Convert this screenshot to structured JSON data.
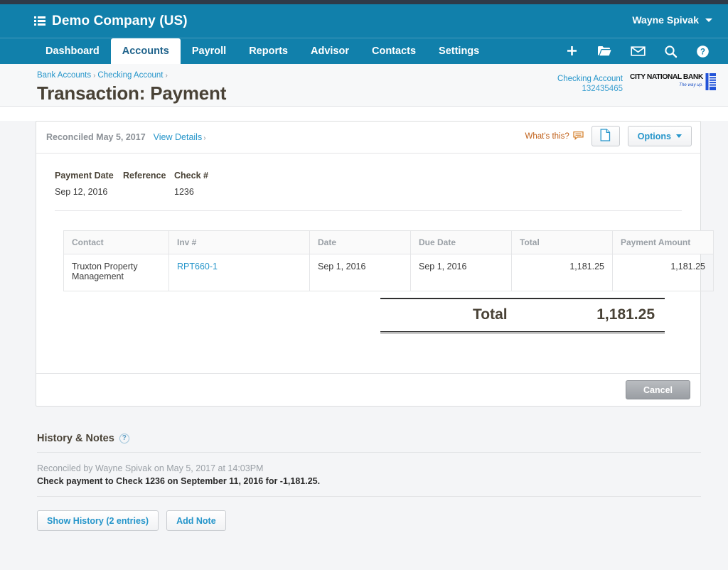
{
  "appbar": {
    "menu_icon": "list-icon",
    "company": "Demo Company (US)",
    "user": "Wayne Spivak",
    "nav": [
      {
        "label": "Dashboard",
        "active": false
      },
      {
        "label": "Accounts",
        "active": true
      },
      {
        "label": "Payroll",
        "active": false
      },
      {
        "label": "Reports",
        "active": false
      },
      {
        "label": "Advisor",
        "active": false
      },
      {
        "label": "Contacts",
        "active": false
      },
      {
        "label": "Settings",
        "active": false
      }
    ],
    "icons": [
      {
        "name": "plus-icon",
        "glyph": "+"
      },
      {
        "name": "folder-icon",
        "glyph": "folder"
      },
      {
        "name": "envelope-icon",
        "glyph": "envelope"
      },
      {
        "name": "search-icon",
        "glyph": "search"
      },
      {
        "name": "help-icon",
        "glyph": "?"
      }
    ]
  },
  "subheader": {
    "breadcrumb": [
      {
        "label": "Bank Accounts"
      },
      {
        "label": "Checking Account"
      }
    ],
    "separator": "›",
    "title": "Transaction: Payment",
    "account_name": "Checking Account",
    "account_number": "132435465",
    "bank_name_1": "C",
    "bank_name": "ITY ",
    "bank_logo_text": "CITY NATIONAL BANK",
    "bank_tagline": "The way up."
  },
  "card": {
    "status": "Reconciled May 5, 2017",
    "view_details": "View Details",
    "view_details_sep": "›",
    "whats_this": "What's this?",
    "document_button_icon": "document-icon",
    "options_label": "Options",
    "meta": [
      {
        "label": "Payment Date",
        "value": "Sep 12, 2016"
      },
      {
        "label": "Reference",
        "value": ""
      },
      {
        "label": "Check #",
        "value": "1236"
      }
    ],
    "table": {
      "columns": [
        {
          "label": "Contact",
          "align": "left"
        },
        {
          "label": "Inv #",
          "align": "left"
        },
        {
          "label": "Date",
          "align": "left"
        },
        {
          "label": "Due Date",
          "align": "left"
        },
        {
          "label": "Total",
          "align": "right"
        },
        {
          "label": "Payment Amount",
          "align": "right"
        }
      ],
      "rows": [
        {
          "contact": "Truxton Property Management",
          "inv": "RPT660-1",
          "date": "Sep 1, 2016",
          "due_date": "Sep 1, 2016",
          "total": "1,181.25",
          "payment_amount": "1,181.25"
        }
      ]
    },
    "total_label": "Total",
    "total_value": "1,181.25",
    "cancel_label": "Cancel"
  },
  "history": {
    "title": "History & Notes",
    "help_glyph": "?",
    "entry_when": "Reconciled by Wayne Spivak on May 5, 2017 at 14:03PM",
    "entry_what": "Check payment to Check 1236 on September 11, 2016 for -1,181.25.",
    "show_history_label": "Show History (2 entries)",
    "add_note_label": "Add Note"
  },
  "colors": {
    "brand": "#1180ab",
    "topstrip": "#2f3b49",
    "link": "#2595ca",
    "accent_orange": "#c06019",
    "page_bg": "#f4f5f7"
  }
}
